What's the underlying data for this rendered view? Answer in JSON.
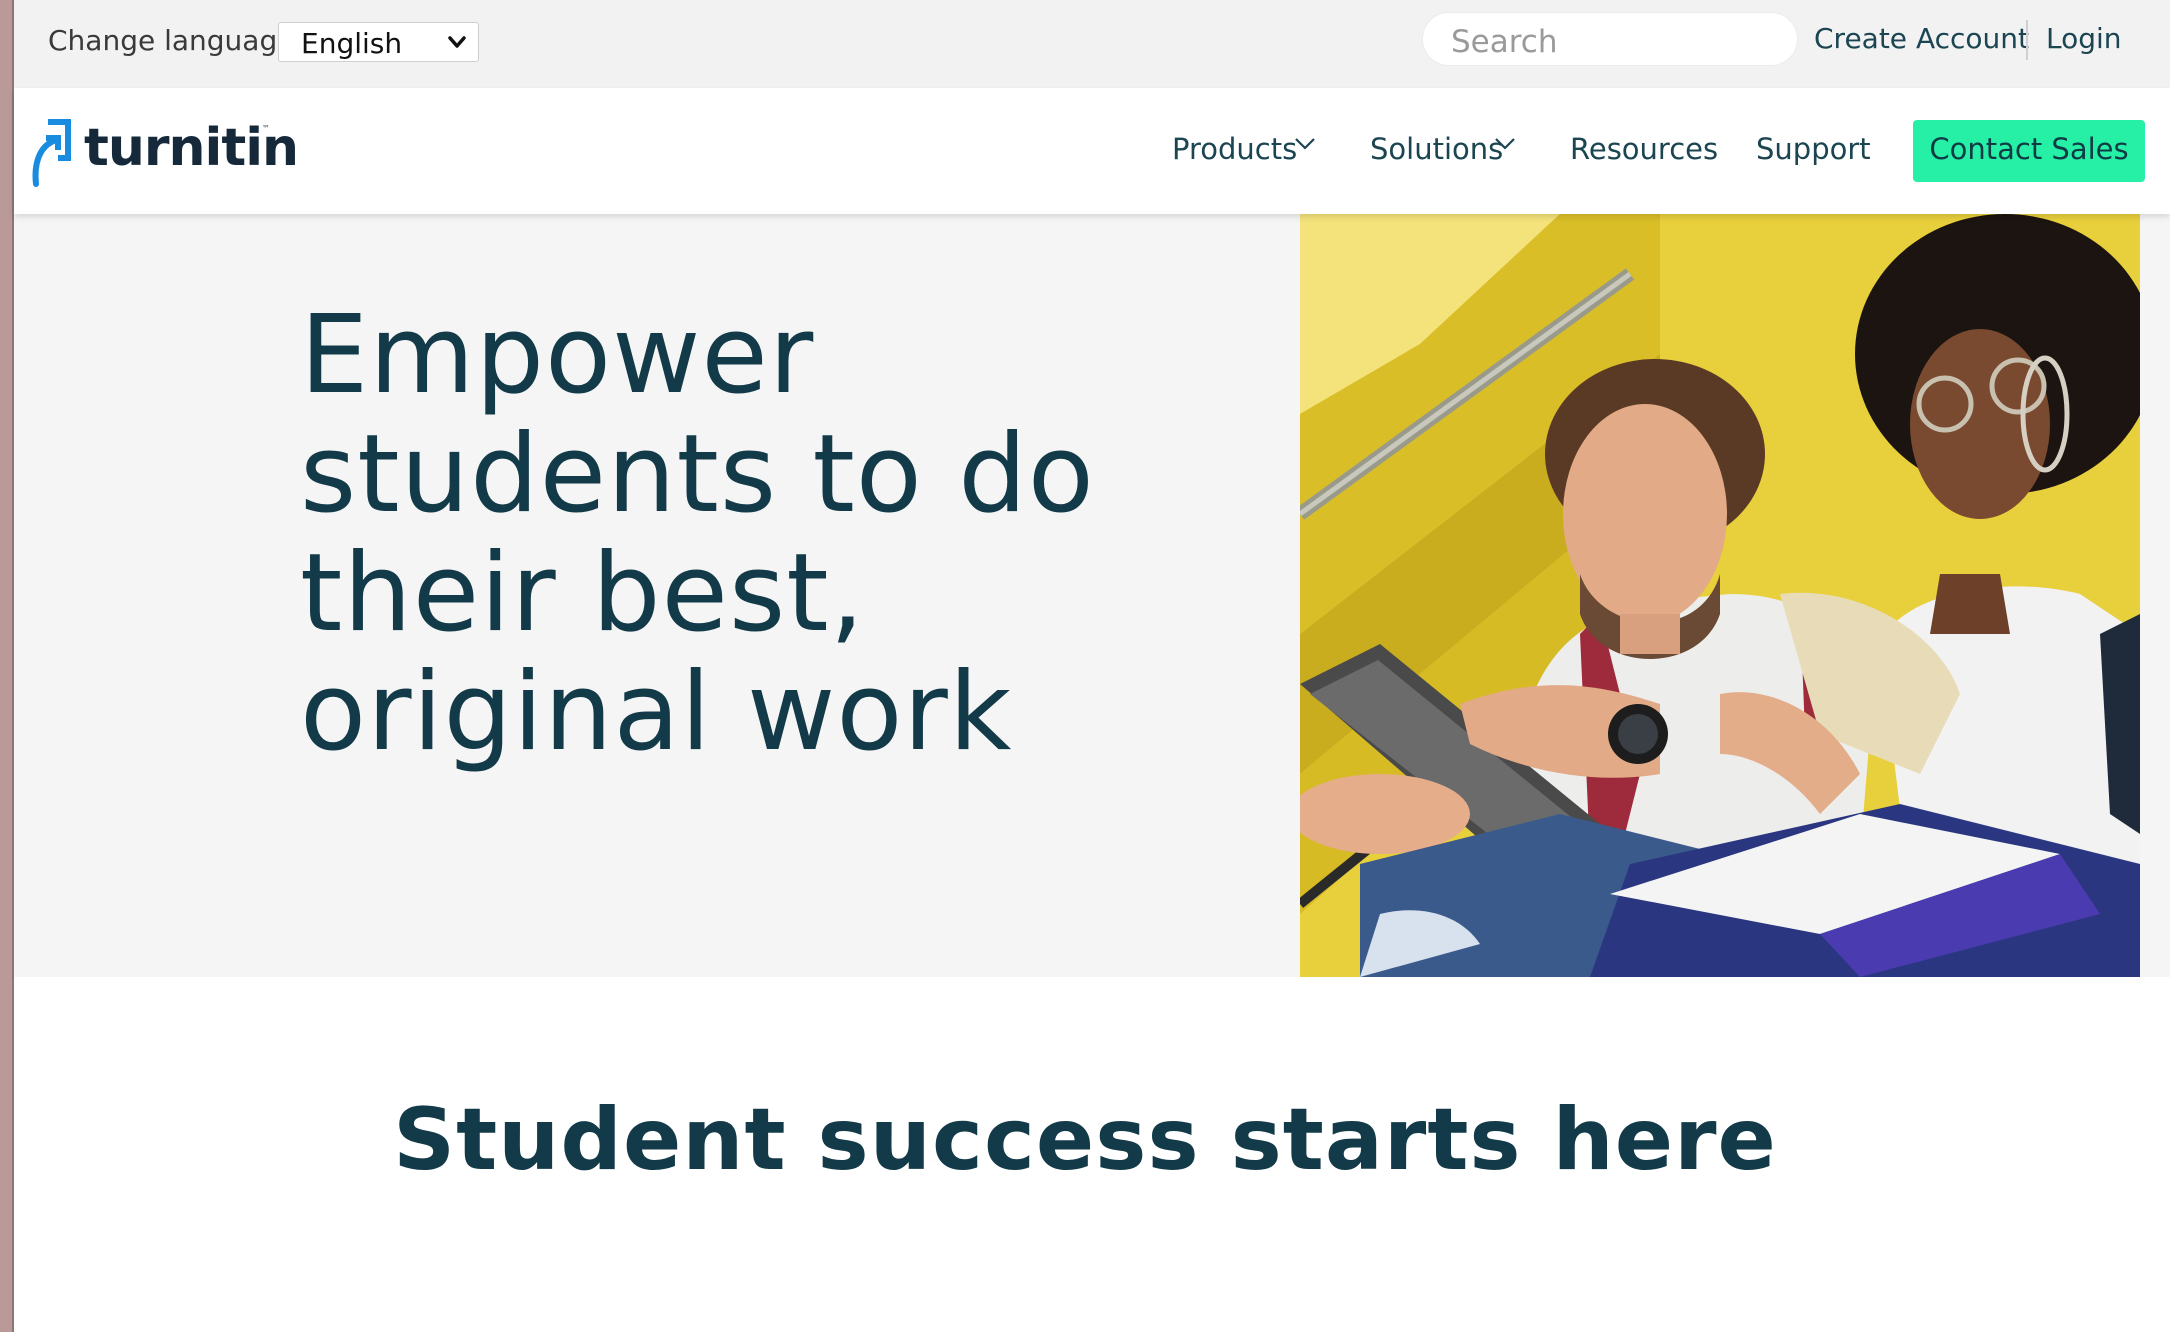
{
  "utility_bar": {
    "language_label": "Change language",
    "language_value": "English",
    "search_placeholder": "Search",
    "create_account": "Create Account",
    "login": "Login"
  },
  "nav": {
    "logo_text": "turnitin",
    "logo_tm": "™",
    "items": [
      {
        "label": "Products",
        "dropdown": true
      },
      {
        "label": "Solutions",
        "dropdown": true
      },
      {
        "label": "Resources",
        "dropdown": false
      },
      {
        "label": "Support",
        "dropdown": false
      }
    ],
    "cta": "Contact Sales"
  },
  "hero": {
    "title_lines": [
      "Empower",
      "students to do",
      "their best,",
      "original work"
    ],
    "image": "students-on-yellow-stairs-photo"
  },
  "section": {
    "title": "Student success starts here"
  },
  "colors": {
    "brand_text": "#133a48",
    "cta_green": "#26f0a6",
    "logo_blue": "#1a8ce0",
    "utility_bg": "#f2f2f2",
    "hero_bg": "#f5f5f5"
  }
}
